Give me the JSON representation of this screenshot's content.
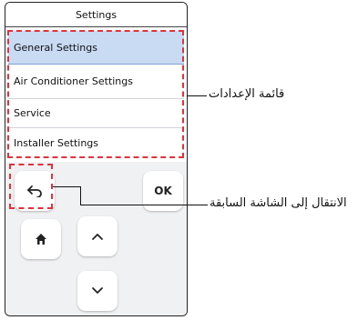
{
  "screen": {
    "title": "Settings"
  },
  "menu": {
    "items": [
      {
        "label": "General Settings",
        "selected": true
      },
      {
        "label": "Air Conditioner Settings",
        "selected": false
      },
      {
        "label": "Service",
        "selected": false
      },
      {
        "label": "Installer Settings",
        "selected": false
      }
    ]
  },
  "keypad": {
    "ok_label": "OK",
    "back_icon": "back-arrow-icon",
    "home_icon": "home-icon",
    "up_icon": "chevron-up-icon",
    "down_icon": "chevron-down-icon"
  },
  "callouts": {
    "menu_label": "قائمة الإعدادات",
    "back_label": "الانتقال إلى الشاشة السابقة"
  },
  "colors": {
    "selected_bg": "#c9daf3",
    "highlight": "#e0323a"
  }
}
